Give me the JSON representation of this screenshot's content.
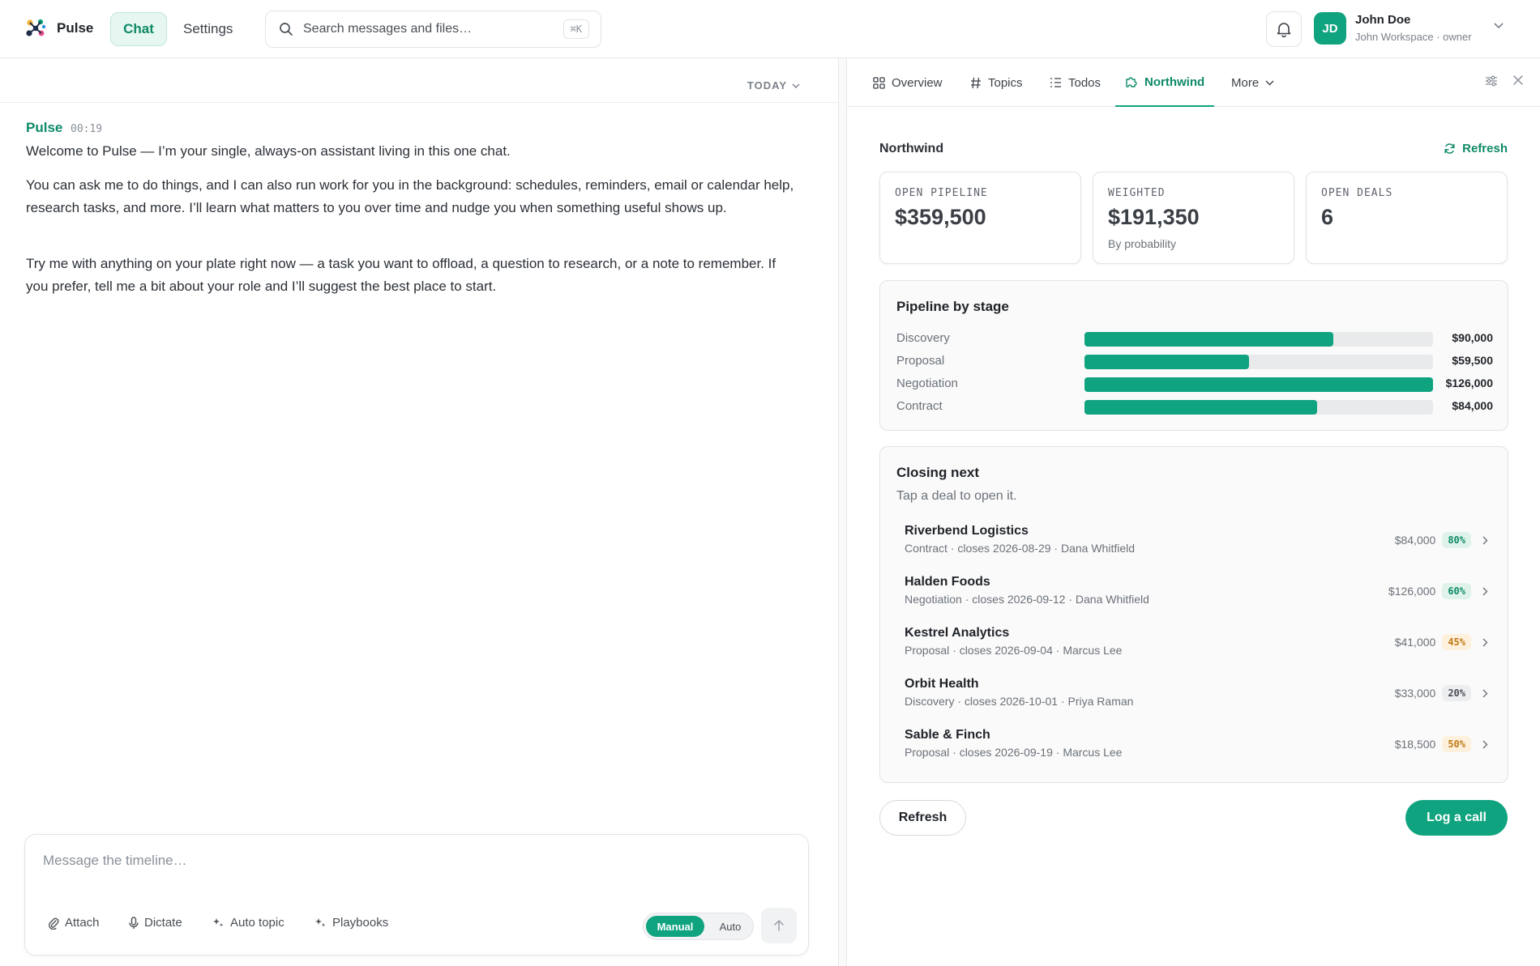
{
  "app": {
    "name": "Pulse"
  },
  "nav": {
    "chat": "Chat",
    "settings": "Settings"
  },
  "search": {
    "placeholder": "Search messages and files…",
    "shortcut": "⌘K"
  },
  "user": {
    "initials": "JD",
    "name": "John Doe",
    "workspace": "John Workspace · owner"
  },
  "timeline": {
    "date_filter": "TODAY"
  },
  "message": {
    "author": "Pulse",
    "time": "00:19",
    "paragraphs": [
      "Welcome to Pulse — I’m your single, always-on assistant living in this one chat.",
      "You can ask me to do things, and I can also run work for you in the background: schedules, reminders, email or calendar help, research tasks, and more. I’ll learn what matters to you over time and nudge you when something useful shows up.",
      "Try me with anything on your plate right now — a task you want to offload, a question to research, or a note to remember. If you prefer, tell me a bit about your role and I’ll suggest the best place to start."
    ]
  },
  "composer": {
    "placeholder": "Message the timeline…",
    "tools": [
      "Attach",
      "Dictate",
      "Auto topic",
      "Playbooks"
    ],
    "mode_manual": "Manual",
    "mode_auto": "Auto",
    "mode_selected": "Manual"
  },
  "panel": {
    "tabs": [
      {
        "label": "Overview",
        "icon": "grid-icon"
      },
      {
        "label": "Topics",
        "icon": "hash-icon"
      },
      {
        "label": "Todos",
        "icon": "list-icon"
      },
      {
        "label": "Northwind",
        "icon": "puzzle-icon",
        "active": true
      },
      {
        "label": "More",
        "icon": "chevron-down-icon"
      }
    ],
    "title": "Northwind",
    "refresh_link": "Refresh",
    "kpis": [
      {
        "label": "OPEN PIPELINE",
        "value": "$359,500",
        "sub": ""
      },
      {
        "label": "WEIGHTED",
        "value": "$191,350",
        "sub": "By probability"
      },
      {
        "label": "OPEN DEALS",
        "value": "6",
        "sub": ""
      }
    ],
    "pipeline": {
      "title": "Pipeline by stage",
      "stages": [
        {
          "name": "Discovery",
          "value": "$90,000",
          "fraction": 0.714
        },
        {
          "name": "Proposal",
          "value": "$59,500",
          "fraction": 0.472
        },
        {
          "name": "Negotiation",
          "value": "$126,000",
          "fraction": 1.0
        },
        {
          "name": "Contract",
          "value": "$84,000",
          "fraction": 0.667
        }
      ]
    },
    "closing": {
      "title": "Closing next",
      "subtitle": "Tap a deal to open it.",
      "deals": [
        {
          "name": "Riverbend Logistics",
          "meta": "Contract · closes 2026-08-29 · Dana Whitfield",
          "amount": "$84,000",
          "prob": "80%",
          "tone": "green"
        },
        {
          "name": "Halden Foods",
          "meta": "Negotiation · closes 2026-09-12 · Dana Whitfield",
          "amount": "$126,000",
          "prob": "60%",
          "tone": "green"
        },
        {
          "name": "Kestrel Analytics",
          "meta": "Proposal · closes 2026-09-04 · Marcus Lee",
          "amount": "$41,000",
          "prob": "45%",
          "tone": "amber"
        },
        {
          "name": "Orbit Health",
          "meta": "Discovery · closes 2026-10-01 · Priya Raman",
          "amount": "$33,000",
          "prob": "20%",
          "tone": "gray"
        },
        {
          "name": "Sable & Finch",
          "meta": "Proposal · closes 2026-09-19 · Marcus Lee",
          "amount": "$18,500",
          "prob": "50%",
          "tone": "amber"
        }
      ]
    },
    "buttons": {
      "refresh": "Refresh",
      "log_call": "Log a call"
    }
  },
  "colors": {
    "accent": "#10a37f",
    "accent_text": "#0e8a68",
    "pill_green_bg": "#dff3ea",
    "pill_amber_bg": "#fdf0dc",
    "pill_amber_text": "#c07a14",
    "pill_gray_bg": "#eceef0"
  }
}
